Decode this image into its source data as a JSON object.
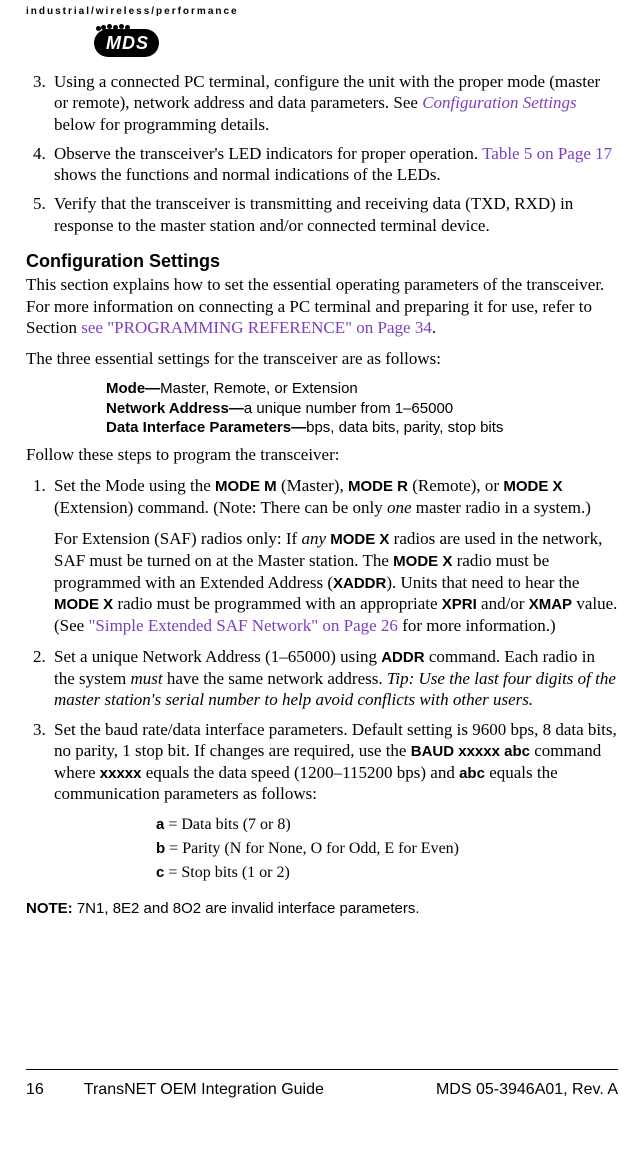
{
  "header_tag": "industrial/wireless/performance",
  "logo_text": "MDS",
  "list_a": {
    "item3": {
      "prefix": "Using a connected PC terminal, configure the unit with the proper mode (master or remote), network address and data parameters. See ",
      "link": "Configuration Settings",
      "suffix": " below for programming details."
    },
    "item4": {
      "prefix": "Observe the transceiver's LED indicators for proper operation. ",
      "link": "Table 5 on Page 17",
      "suffix": " shows the functions and normal indications of the LEDs."
    },
    "item5": "Verify that the transceiver is transmitting and receiving data (TXD, RXD) in response to the master station and/or connected terminal device."
  },
  "heading": "Configuration Settings",
  "para1": {
    "prefix": "This section explains how to set the essential operating parameters of the transceiver. For more information on connecting a PC terminal and preparing it for use, refer to Section ",
    "link": "see \"PROGRAMMING REFERENCE\" on Page 34",
    "suffix": "."
  },
  "para2": "The three essential settings for the transceiver are as follows:",
  "params": {
    "mode_label": "Mode—",
    "mode_text": "Master, Remote, or Extension",
    "net_label": "Network Address—",
    "net_text": "a unique number from 1–65000",
    "dip_label": "Data Interface Parameters—",
    "dip_text": "bps, data bits, parity, stop bits"
  },
  "para3": "Follow these steps to program the transceiver:",
  "list_b": {
    "item1": {
      "p1_a": "Set the Mode using the ",
      "p1_b": "MODE M",
      "p1_c": " (Master), ",
      "p1_d": "MODE R",
      "p1_e": " (Remote), or ",
      "p1_f": "MODE X",
      "p1_g": " (Extension) command. (Note: There can be only ",
      "p1_h": "one",
      "p1_i": " master radio in a system.)",
      "p2_a": "For Extension (SAF) radios only: If ",
      "p2_b": "any",
      "p2_c": " ",
      "p2_d": "MODE X",
      "p2_e": " radios are used in the network, SAF must be turned on at the Master station. The ",
      "p2_f": "MODE X",
      "p2_g": " radio must be programmed with an Extended Address (",
      "p2_h": "XADDR",
      "p2_i": "). Units that need to hear the ",
      "p2_j": "MODE X",
      "p2_k": " radio must be programmed with an appropriate ",
      "p2_l": "XPRI",
      "p2_m": " and/or ",
      "p2_n": "XMAP",
      "p2_o": " value. (See ",
      "p2_link": "\"Simple Extended SAF Network\" on Page 26",
      "p2_p": " for more information.)"
    },
    "item2": {
      "a": "Set a unique Network Address (1–65000) using ",
      "b": "ADDR",
      "c": " command. Each radio in the system ",
      "d": "must",
      "e": " have the same network address. ",
      "f": "Tip: Use the last four digits of the master station's serial number to help avoid conflicts with other users."
    },
    "item3": {
      "a": "Set the baud rate/data interface parameters. Default setting is 9600 bps, 8 data bits, no parity, 1 stop bit. If changes are required, use the ",
      "b": "BAUD xxxxx abc",
      "c": " command where ",
      "d": "xxxxx",
      "e": " equals the data speed (1200–115200 bps) and ",
      "f": "abc",
      "g": " equals the communication parameters as follows:"
    }
  },
  "abc": {
    "a_code": "a",
    "a_text": " = Data bits (7 or 8)",
    "b_code": "b",
    "b_text": " = Parity (N for None, O for Odd, E for Even)",
    "c_code": "c",
    "c_text": " = Stop bits (1 or 2)"
  },
  "note": {
    "lead": "NOTE:",
    "text": " 7N1, 8E2 and 8O2 are invalid interface parameters."
  },
  "footer": {
    "page": "16",
    "title": "TransNET OEM Integration Guide",
    "rev": "MDS 05-3946A01, Rev.  A"
  }
}
